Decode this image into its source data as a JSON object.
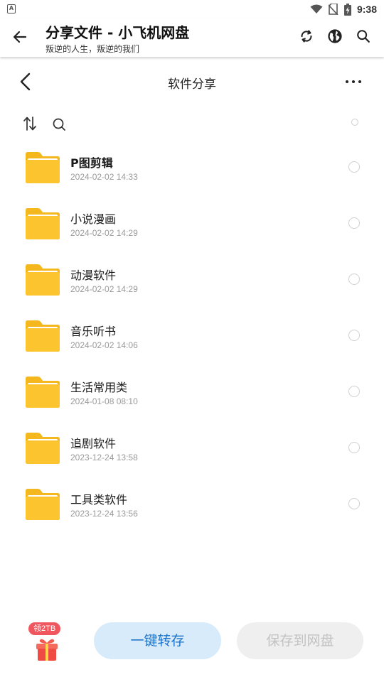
{
  "status_bar": {
    "time": "9:38",
    "app_icon_letter": "A"
  },
  "app_bar": {
    "title": "分享文件 - 小飞机网盘",
    "subtitle": "叛逆的人生，叛逆的我们"
  },
  "page_header": {
    "title": "软件分享"
  },
  "files": [
    {
      "name": "P图剪辑",
      "date": "2024-02-02 14:33"
    },
    {
      "name": "小说漫画",
      "date": "2024-02-02 14:29"
    },
    {
      "name": "动漫软件",
      "date": "2024-02-02 14:29"
    },
    {
      "name": "音乐听书",
      "date": "2024-02-02 14:06"
    },
    {
      "name": "生活常用类",
      "date": "2024-01-08 08:10"
    },
    {
      "name": "追剧软件",
      "date": "2023-12-24 13:58"
    },
    {
      "name": "工具类软件",
      "date": "2023-12-24 13:56"
    }
  ],
  "bottom": {
    "gift_badge": "领2TB",
    "transfer_label": "一键转存",
    "save_label": "保存到网盘"
  },
  "colors": {
    "folder": "#fcc52f",
    "accent_blue": "#1e74c9",
    "transfer_bg": "#d8ebfb",
    "badge_red": "#f0565d"
  },
  "icons": [
    "back-arrow-icon",
    "refresh-icon",
    "globe-icon",
    "search-icon",
    "chevron-left-icon",
    "more-icon",
    "sort-icon",
    "folder-icon",
    "gift-icon"
  ]
}
